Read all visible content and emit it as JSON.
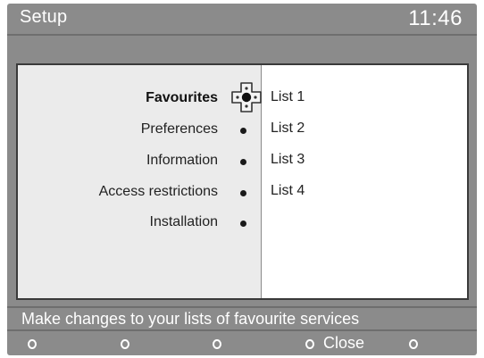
{
  "header": {
    "title": "Setup",
    "clock": "11:46"
  },
  "menu": {
    "items": [
      {
        "label": "Favourites",
        "active": true
      },
      {
        "label": "Preferences",
        "active": false
      },
      {
        "label": "Information",
        "active": false
      },
      {
        "label": "Access restrictions",
        "active": false
      },
      {
        "label": "Installation",
        "active": false
      }
    ],
    "cursor_icon": "navigation-cross-icon"
  },
  "submenu": {
    "items": [
      "List 1",
      "List 2",
      "List 3",
      "List 4"
    ]
  },
  "info_bar": {
    "text": "Make changes to your lists of favourite services"
  },
  "buttons": {
    "close_label": "Close",
    "key_icon": "ring-key-icon"
  },
  "colors": {
    "background": "#8b8b8b",
    "panel_left": "#ebebeb",
    "panel_right": "#ffffff",
    "text_light": "#ffffff",
    "text_dark": "#222222"
  }
}
